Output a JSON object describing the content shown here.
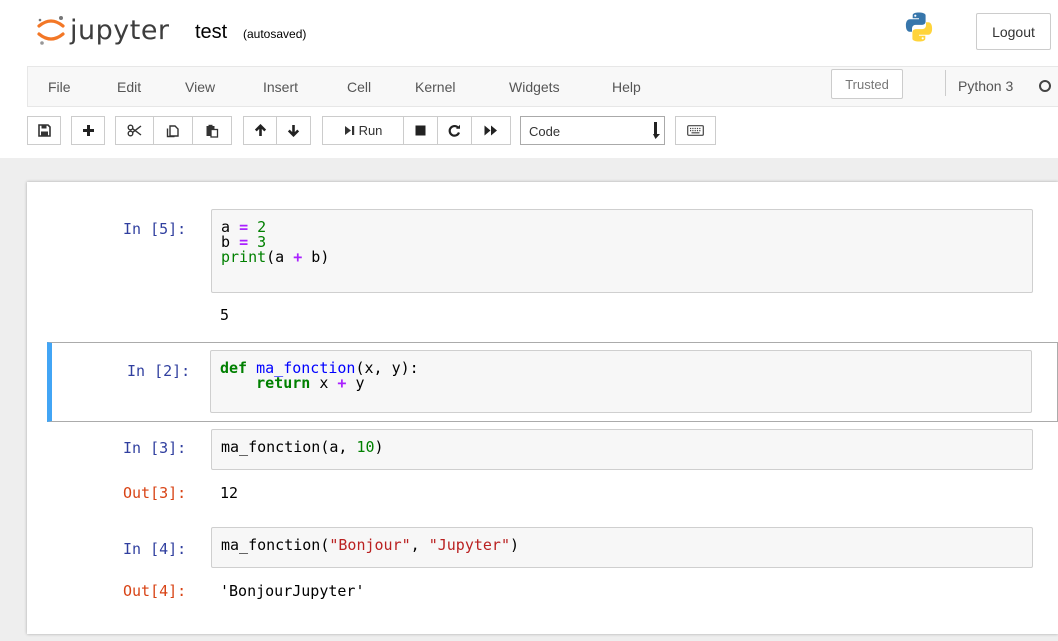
{
  "header": {
    "logo_text": "jupyter",
    "notebook_name": "test",
    "autosave_status": "(autosaved)",
    "logout_label": "Logout",
    "python_logo_icon": "python-logo-icon"
  },
  "menubar": {
    "items": [
      "File",
      "Edit",
      "View",
      "Insert",
      "Cell",
      "Kernel",
      "Widgets",
      "Help"
    ],
    "trusted_label": "Trusted",
    "kernel_name": "Python 3",
    "kernel_indicator": "kernel-idle-circle-icon"
  },
  "toolbar": {
    "save_icon": "floppy-disk-icon",
    "insert_icon": "plus-icon",
    "cut_icon": "scissors-icon",
    "copy_icon": "copy-icon",
    "paste_icon": "paste-icon",
    "move_up_icon": "arrow-up-icon",
    "move_down_icon": "arrow-down-icon",
    "run_label": "Run",
    "run_icon": "step-forward-icon",
    "interrupt_icon": "stop-icon",
    "restart_icon": "redo-icon",
    "restart_run_all_icon": "fast-forward-icon",
    "cell_type": "Code",
    "command_palette_icon": "keyboard-icon"
  },
  "cells": [
    {
      "prompt": "In [5]:",
      "tokens": [
        [
          [
            "p",
            "a "
          ],
          [
            "op",
            "="
          ],
          [
            "p",
            " "
          ],
          [
            "num",
            "2"
          ]
        ],
        [
          [
            "p",
            "b "
          ],
          [
            "op",
            "="
          ],
          [
            "p",
            " "
          ],
          [
            "num",
            "3"
          ]
        ],
        [
          [
            "bi",
            "print"
          ],
          [
            "p",
            "(a "
          ],
          [
            "op",
            "+"
          ],
          [
            "p",
            " b)"
          ]
        ]
      ],
      "output": "5",
      "output_prompt": ""
    },
    {
      "prompt": "In [2]:",
      "tokens": [
        [
          [
            "kw",
            "def"
          ],
          [
            "p",
            " "
          ],
          [
            "fn",
            "ma_fonction"
          ],
          [
            "p",
            "(x, y):"
          ]
        ],
        [
          [
            "p",
            "    "
          ],
          [
            "kw",
            "return"
          ],
          [
            "p",
            " x "
          ],
          [
            "op",
            "+"
          ],
          [
            "p",
            " y"
          ]
        ]
      ],
      "selected": true
    },
    {
      "prompt": "In [3]:",
      "tokens": [
        [
          [
            "p",
            "ma_fonction(a, "
          ],
          [
            "num",
            "10"
          ],
          [
            "p",
            ")"
          ]
        ]
      ],
      "output_prompt": "Out[3]:",
      "output": "12"
    },
    {
      "prompt": "In [4]:",
      "tokens": [
        [
          [
            "p",
            "ma_fonction("
          ],
          [
            "str",
            "\"Bonjour\""
          ],
          [
            "p",
            ", "
          ],
          [
            "str",
            "\"Jupyter\""
          ],
          [
            "p",
            ")"
          ]
        ]
      ],
      "output_prompt": "Out[4]:",
      "output": "'BonjourJupyter'"
    }
  ]
}
